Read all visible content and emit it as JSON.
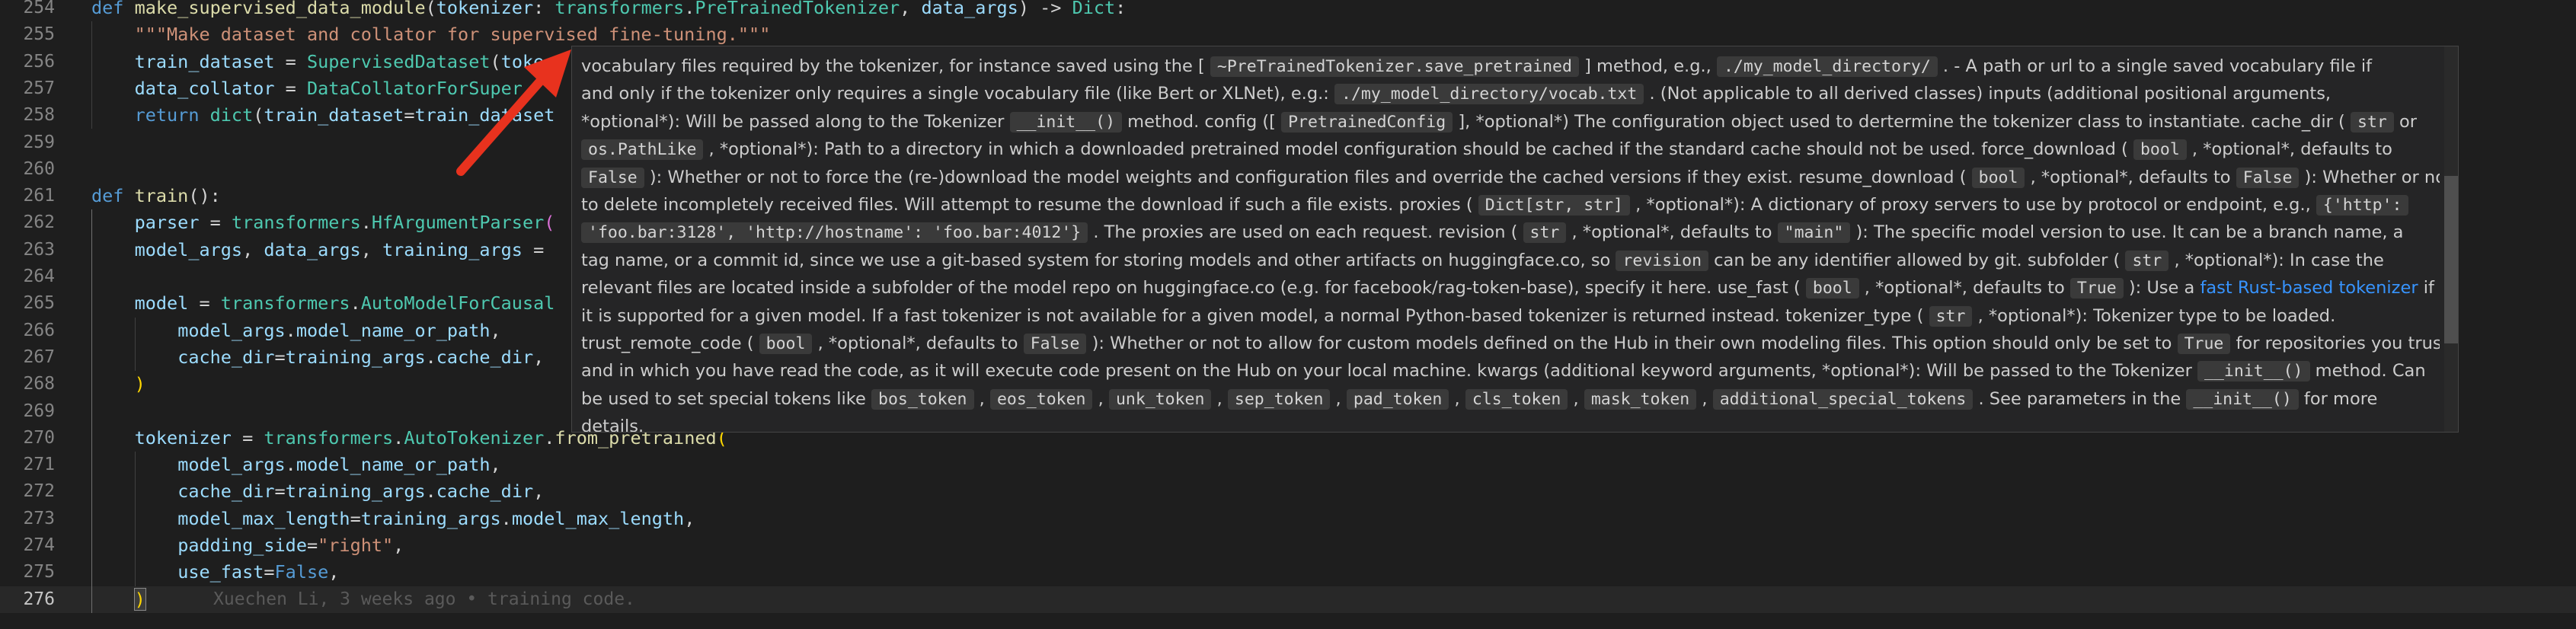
{
  "editor": {
    "lines": [
      {
        "n": "254",
        "t": [
          [
            "def ",
            "kw"
          ],
          [
            "make_supervised_data_module",
            "fn"
          ],
          [
            "(",
            "pun"
          ],
          [
            "tokenizer",
            "var"
          ],
          [
            ": ",
            "pun"
          ],
          [
            "transformers",
            "cls"
          ],
          [
            ".",
            "pun"
          ],
          [
            "PreTrainedTokenizer",
            "cls"
          ],
          [
            ", ",
            "pun"
          ],
          [
            "data_args",
            "var"
          ],
          [
            ") -> ",
            "pun"
          ],
          [
            "Dict",
            "cls"
          ],
          [
            ":",
            "pun"
          ]
        ]
      },
      {
        "n": "255",
        "t": [
          [
            "    ",
            "pun"
          ],
          [
            "\"\"\"Make dataset and collator for supervised fine-tuning.\"\"\"",
            "str"
          ]
        ]
      },
      {
        "n": "256",
        "t": [
          [
            "    ",
            "pun"
          ],
          [
            "train_dataset",
            "var"
          ],
          [
            " = ",
            "pun"
          ],
          [
            "SupervisedDataset",
            "cls"
          ],
          [
            "(",
            "pun"
          ],
          [
            "toke",
            "var"
          ]
        ]
      },
      {
        "n": "257",
        "t": [
          [
            "    ",
            "pun"
          ],
          [
            "data_collator",
            "var"
          ],
          [
            " = ",
            "pun"
          ],
          [
            "DataCollatorForSuper",
            "cls"
          ]
        ]
      },
      {
        "n": "258",
        "t": [
          [
            "    ",
            "pun"
          ],
          [
            "return ",
            "kw"
          ],
          [
            "dict",
            "cls"
          ],
          [
            "(",
            "pun"
          ],
          [
            "train_dataset",
            "var"
          ],
          [
            "=",
            "pun"
          ],
          [
            "train_dataset",
            "var"
          ]
        ]
      },
      {
        "n": "259",
        "t": []
      },
      {
        "n": "260",
        "t": []
      },
      {
        "n": "261",
        "t": [
          [
            "def ",
            "kw"
          ],
          [
            "train",
            "fn"
          ],
          [
            "():",
            "pun"
          ]
        ]
      },
      {
        "n": "262",
        "t": [
          [
            "    ",
            "pun"
          ],
          [
            "parser",
            "var"
          ],
          [
            " = ",
            "pun"
          ],
          [
            "transformers",
            "cls"
          ],
          [
            ".",
            "pun"
          ],
          [
            "HfArgumentParser",
            "cls"
          ],
          [
            "(",
            "brk2"
          ]
        ]
      },
      {
        "n": "263",
        "t": [
          [
            "    ",
            "pun"
          ],
          [
            "model_args",
            "var"
          ],
          [
            ", ",
            "pun"
          ],
          [
            "data_args",
            "var"
          ],
          [
            ", ",
            "pun"
          ],
          [
            "training_args",
            "var"
          ],
          [
            " =",
            "pun"
          ]
        ]
      },
      {
        "n": "264",
        "t": []
      },
      {
        "n": "265",
        "t": [
          [
            "    ",
            "pun"
          ],
          [
            "model",
            "var"
          ],
          [
            " = ",
            "pun"
          ],
          [
            "transformers",
            "cls"
          ],
          [
            ".",
            "pun"
          ],
          [
            "AutoModelForCausal",
            "cls"
          ]
        ]
      },
      {
        "n": "266",
        "t": [
          [
            "        ",
            "pun"
          ],
          [
            "model_args",
            "var"
          ],
          [
            ".",
            "pun"
          ],
          [
            "model_name_or_path",
            "var"
          ],
          [
            ",",
            "pun"
          ]
        ]
      },
      {
        "n": "267",
        "t": [
          [
            "        ",
            "pun"
          ],
          [
            "cache_dir",
            "var"
          ],
          [
            "=",
            "pun"
          ],
          [
            "training_args",
            "var"
          ],
          [
            ".",
            "pun"
          ],
          [
            "cache_dir",
            "var"
          ],
          [
            ",",
            "pun"
          ]
        ]
      },
      {
        "n": "268",
        "t": [
          [
            "    ",
            "pun"
          ],
          [
            ")",
            "brk1"
          ]
        ]
      },
      {
        "n": "269",
        "t": []
      },
      {
        "n": "270",
        "t": [
          [
            "    ",
            "pun"
          ],
          [
            "tokenizer",
            "var"
          ],
          [
            " = ",
            "pun"
          ],
          [
            "transformers",
            "cls"
          ],
          [
            ".",
            "pun"
          ],
          [
            "AutoTokenizer",
            "cls"
          ],
          [
            ".",
            "pun"
          ],
          [
            "from_pretrained",
            "fn"
          ],
          [
            "(",
            "brk1"
          ]
        ]
      },
      {
        "n": "271",
        "t": [
          [
            "        ",
            "pun"
          ],
          [
            "model_args",
            "var"
          ],
          [
            ".",
            "pun"
          ],
          [
            "model_name_or_path",
            "var"
          ],
          [
            ",",
            "pun"
          ]
        ]
      },
      {
        "n": "272",
        "t": [
          [
            "        ",
            "pun"
          ],
          [
            "cache_dir",
            "var"
          ],
          [
            "=",
            "pun"
          ],
          [
            "training_args",
            "var"
          ],
          [
            ".",
            "pun"
          ],
          [
            "cache_dir",
            "var"
          ],
          [
            ",",
            "pun"
          ]
        ]
      },
      {
        "n": "273",
        "t": [
          [
            "        ",
            "pun"
          ],
          [
            "model_max_length",
            "var"
          ],
          [
            "=",
            "pun"
          ],
          [
            "training_args",
            "var"
          ],
          [
            ".",
            "pun"
          ],
          [
            "model_max_length",
            "var"
          ],
          [
            ",",
            "pun"
          ]
        ]
      },
      {
        "n": "274",
        "t": [
          [
            "        ",
            "pun"
          ],
          [
            "padding_side",
            "var"
          ],
          [
            "=",
            "pun"
          ],
          [
            "\"right\"",
            "str"
          ],
          [
            ",",
            "pun"
          ]
        ]
      },
      {
        "n": "275",
        "t": [
          [
            "        ",
            "pun"
          ],
          [
            "use_fast",
            "var"
          ],
          [
            "=",
            "pun"
          ],
          [
            "False",
            "bool"
          ],
          [
            ",",
            "pun"
          ]
        ]
      },
      {
        "n": "276",
        "t": [
          [
            "    ",
            "pun"
          ],
          [
            ")",
            "brk1"
          ]
        ]
      }
    ],
    "blame": "Xuechen Li, 3 weeks ago • training code."
  },
  "hover": {
    "lines": [
      [
        [
          "t",
          "vocabulary files required by the tokenizer, for instance saved using the [ "
        ],
        [
          "c",
          "~PreTrainedTokenizer.save_pretrained"
        ],
        [
          "t",
          " ] method, e.g., "
        ],
        [
          "c",
          "./my_model_directory/"
        ],
        [
          "t",
          " . - A path or url to a single saved vocabulary file if"
        ]
      ],
      [
        [
          "t",
          "and only if the tokenizer only requires a single vocabulary file (like Bert or XLNet), e.g.: "
        ],
        [
          "c",
          "./my_model_directory/vocab.txt"
        ],
        [
          "t",
          " . (Not applicable to all derived classes) inputs (additional positional arguments,"
        ]
      ],
      [
        [
          "t",
          "*optional*): Will be passed along to the Tokenizer "
        ],
        [
          "c",
          "__init__()"
        ],
        [
          "t",
          " method. config ([ "
        ],
        [
          "c",
          "PretrainedConfig"
        ],
        [
          "t",
          " ], *optional*) The configuration object used to dertermine the tokenizer class to instantiate. cache_dir ( "
        ],
        [
          "c",
          "str"
        ],
        [
          "t",
          " or"
        ]
      ],
      [
        [
          "c",
          "os.PathLike"
        ],
        [
          "t",
          " , *optional*): Path to a directory in which a downloaded pretrained model configuration should be cached if the standard cache should not be used. force_download ( "
        ],
        [
          "c",
          "bool"
        ],
        [
          "t",
          " , *optional*, defaults to"
        ]
      ],
      [
        [
          "c",
          "False"
        ],
        [
          "t",
          " ): Whether or not to force the (re-)download the model weights and configuration files and override the cached versions if they exist. resume_download ( "
        ],
        [
          "c",
          "bool"
        ],
        [
          "t",
          " , *optional*, defaults to "
        ],
        [
          "c",
          "False"
        ],
        [
          "t",
          " ): Whether or not"
        ]
      ],
      [
        [
          "t",
          "to delete incompletely received files. Will attempt to resume the download if such a file exists. proxies ( "
        ],
        [
          "c",
          "Dict[str, str]"
        ],
        [
          "t",
          " , *optional*): A dictionary of proxy servers to use by protocol or endpoint, e.g., "
        ],
        [
          "c",
          "{'http':"
        ]
      ],
      [
        [
          "c",
          "'foo.bar:3128', 'http://hostname': 'foo.bar:4012'}"
        ],
        [
          "t",
          " . The proxies are used on each request. revision ( "
        ],
        [
          "c",
          "str"
        ],
        [
          "t",
          " , *optional*, defaults to "
        ],
        [
          "c",
          "\"main\""
        ],
        [
          "t",
          " ): The specific model version to use. It can be a branch name, a"
        ]
      ],
      [
        [
          "t",
          "tag name, or a commit id, since we use a git-based system for storing models and other artifacts on huggingface.co, so "
        ],
        [
          "c",
          "revision"
        ],
        [
          "t",
          " can be any identifier allowed by git. subfolder ( "
        ],
        [
          "c",
          "str"
        ],
        [
          "t",
          " , *optional*): In case the"
        ]
      ],
      [
        [
          "t",
          "relevant files are located inside a subfolder of the model repo on huggingface.co (e.g. for facebook/rag-token-base), specify it here. use_fast ( "
        ],
        [
          "c",
          "bool"
        ],
        [
          "t",
          " , *optional*, defaults to "
        ],
        [
          "c",
          "True"
        ],
        [
          "t",
          " ): Use a "
        ],
        [
          "l",
          "fast Rust-based tokenizer"
        ],
        [
          "t",
          " if"
        ]
      ],
      [
        [
          "t",
          "it is supported for a given model. If a fast tokenizer is not available for a given model, a normal Python-based tokenizer is returned instead. tokenizer_type ( "
        ],
        [
          "c",
          "str"
        ],
        [
          "t",
          " , *optional*): Tokenizer type to be loaded."
        ]
      ],
      [
        [
          "t",
          "trust_remote_code ( "
        ],
        [
          "c",
          "bool"
        ],
        [
          "t",
          " , *optional*, defaults to "
        ],
        [
          "c",
          "False"
        ],
        [
          "t",
          " ): Whether or not to allow for custom models defined on the Hub in their own modeling files. This option should only be set to "
        ],
        [
          "c",
          "True"
        ],
        [
          "t",
          " for repositories you trust"
        ]
      ],
      [
        [
          "t",
          "and in which you have read the code, as it will execute code present on the Hub on your local machine. kwargs (additional keyword arguments, *optional*): Will be passed to the Tokenizer "
        ],
        [
          "c",
          "__init__()"
        ],
        [
          "t",
          " method. Can"
        ]
      ],
      [
        [
          "t",
          "be used to set special tokens like "
        ],
        [
          "c",
          "bos_token"
        ],
        [
          "t",
          " , "
        ],
        [
          "c",
          "eos_token"
        ],
        [
          "t",
          " , "
        ],
        [
          "c",
          "unk_token"
        ],
        [
          "t",
          " , "
        ],
        [
          "c",
          "sep_token"
        ],
        [
          "t",
          " , "
        ],
        [
          "c",
          "pad_token"
        ],
        [
          "t",
          " , "
        ],
        [
          "c",
          "cls_token"
        ],
        [
          "t",
          " , "
        ],
        [
          "c",
          "mask_token"
        ],
        [
          "t",
          " , "
        ],
        [
          "c",
          "additional_special_tokens"
        ],
        [
          "t",
          " . See parameters in the "
        ],
        [
          "c",
          "__init__()"
        ],
        [
          "t",
          " for more"
        ]
      ],
      [
        [
          "t",
          "details."
        ]
      ]
    ]
  },
  "annotation": {
    "color": "#e8321e",
    "icon": "arrow-annotation"
  }
}
